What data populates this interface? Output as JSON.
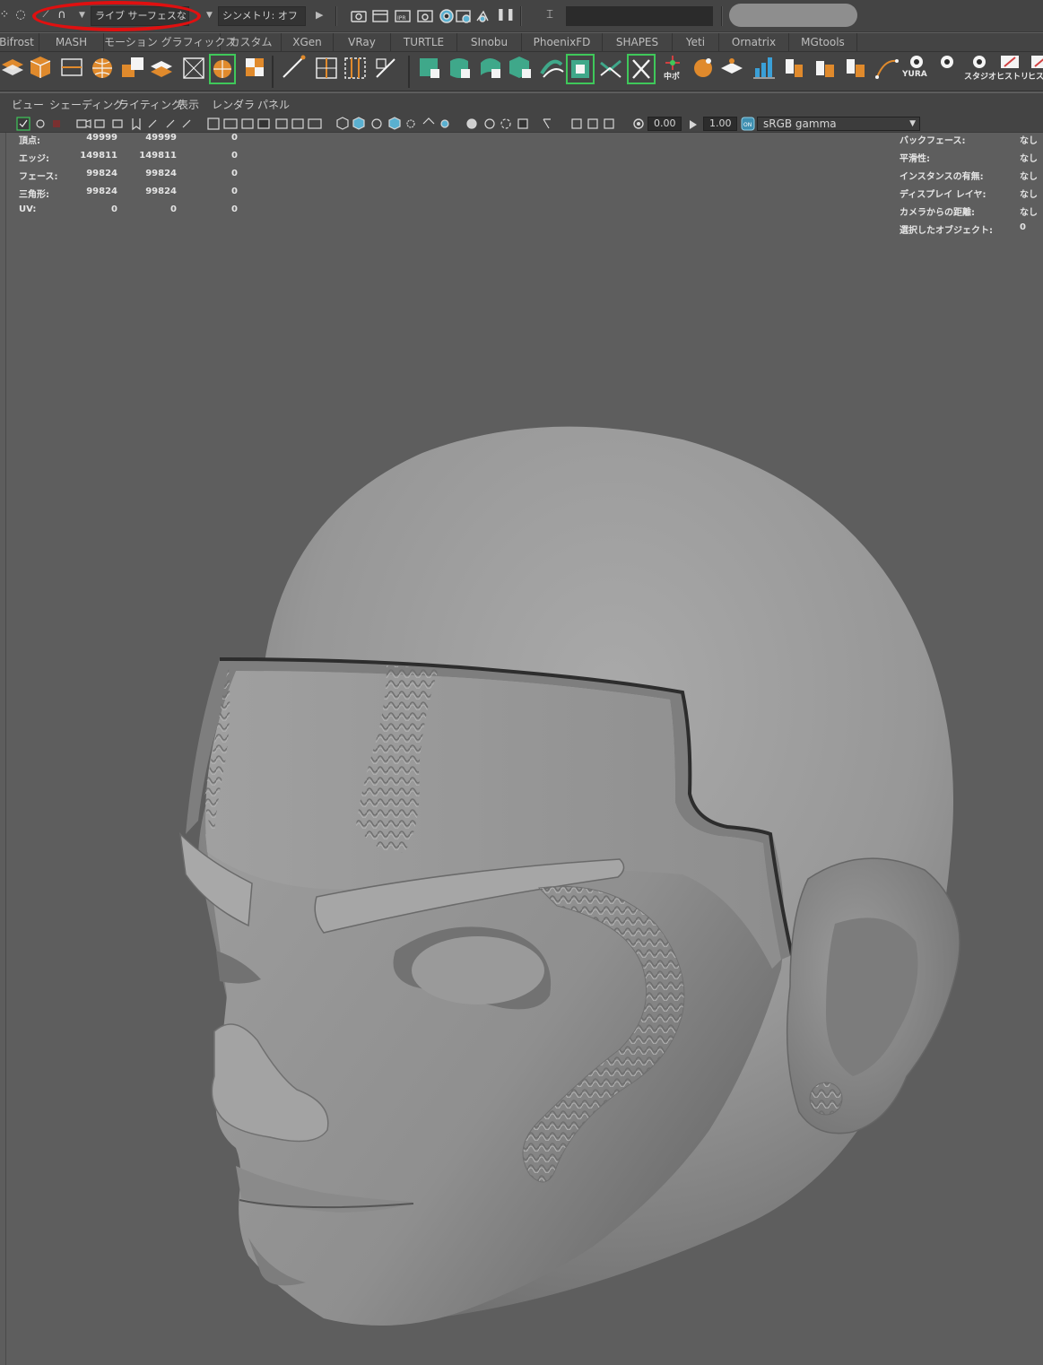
{
  "status_line": {
    "live_surface_label": "ライブ サーフェスなし",
    "symmetry_label": "シンメトリ: オフ",
    "search_value": ""
  },
  "shelf_tabs": [
    "Bifrost",
    "MASH",
    "モーション グラフィックス",
    "カスタム",
    "XGen",
    "VRay",
    "TURTLE",
    "SInobu",
    "PhoenixFD",
    "SHAPES",
    "Yeti",
    "Ornatrix",
    "MGtools"
  ],
  "shelf": {
    "labels": {
      "center": "中ポ",
      "yura": "YURA",
      "studio": "スタジオ",
      "history": "ヒストリ",
      "history2": "ヒス"
    }
  },
  "panel_menu": [
    "ビュー",
    "シェーディング",
    "ライティング",
    "表示",
    "レンダラ",
    "パネル"
  ],
  "panel_toolbar": {
    "exposure": "0.00",
    "gamma": "1.00",
    "color_space": "sRGB gamma"
  },
  "hud": {
    "poly_count": {
      "rows": [
        {
          "label": "頂点:",
          "a": "49999",
          "b": "49999",
          "c": "0"
        },
        {
          "label": "エッジ:",
          "a": "149811",
          "b": "149811",
          "c": "0"
        },
        {
          "label": "フェース:",
          "a": "99824",
          "b": "99824",
          "c": "0"
        },
        {
          "label": "三角形:",
          "a": "99824",
          "b": "99824",
          "c": "0"
        },
        {
          "label": "UV:",
          "a": "0",
          "b": "0",
          "c": "0"
        }
      ]
    },
    "object_details": {
      "rows": [
        {
          "label": "バックフェース:",
          "value": "なし"
        },
        {
          "label": "平滑性:",
          "value": "なし"
        },
        {
          "label": "インスタンスの有無:",
          "value": "なし"
        },
        {
          "label": "ディスプレイ レイヤ:",
          "value": "なし"
        },
        {
          "label": "カメラからの距離:",
          "value": "なし"
        },
        {
          "label": "選択したオブジェクト:",
          "value": "0"
        }
      ]
    }
  },
  "colors": {
    "annotation_ring": "#e01010",
    "shelf_green": "#3fa88a",
    "shelf_orange": "#e08a2c",
    "viewport_bg": "#5e5e5e"
  }
}
